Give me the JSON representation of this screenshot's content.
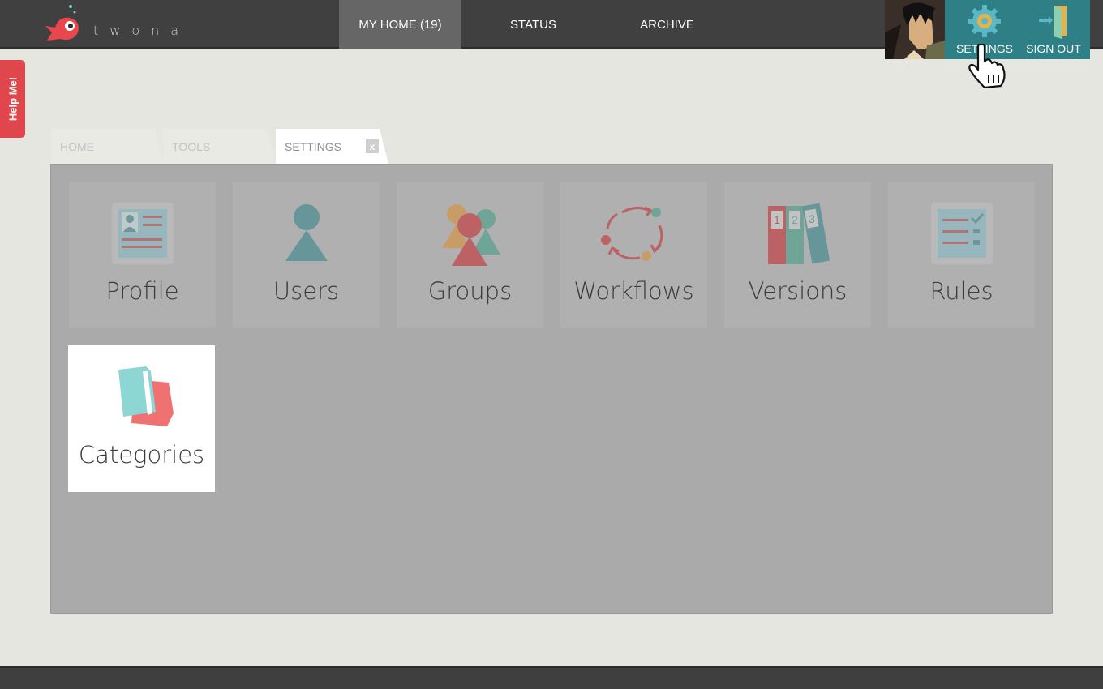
{
  "brand": {
    "name": "twona"
  },
  "nav": [
    {
      "label": "MY HOME (19)",
      "active": true
    },
    {
      "label": "STATUS",
      "active": false
    },
    {
      "label": "ARCHIVE",
      "active": false
    }
  ],
  "user_menu": {
    "settings": "SETTINGS",
    "sign_out": "SIGN OUT"
  },
  "help": {
    "label": "Help Me!"
  },
  "tabs": [
    {
      "label": "HOME"
    },
    {
      "label": "TOOLS"
    },
    {
      "label": "SETTINGS",
      "close": "x"
    }
  ],
  "tiles": [
    {
      "label": "Profile",
      "icon": "profile-card-icon"
    },
    {
      "label": "Users",
      "icon": "user-icon"
    },
    {
      "label": "Groups",
      "icon": "group-icon"
    },
    {
      "label": "Workflows",
      "icon": "workflow-cycle-icon"
    },
    {
      "label": "Versions",
      "icon": "binders-icon"
    },
    {
      "label": "Rules",
      "icon": "checklist-icon"
    },
    {
      "label": "Categories",
      "icon": "folders-icon"
    }
  ],
  "binder_numbers": [
    "1",
    "2",
    "3"
  ],
  "colors": {
    "accent": "#2f7f86",
    "topbar": "#404040",
    "help": "#e0474c",
    "panel": "#aaaaaa"
  }
}
